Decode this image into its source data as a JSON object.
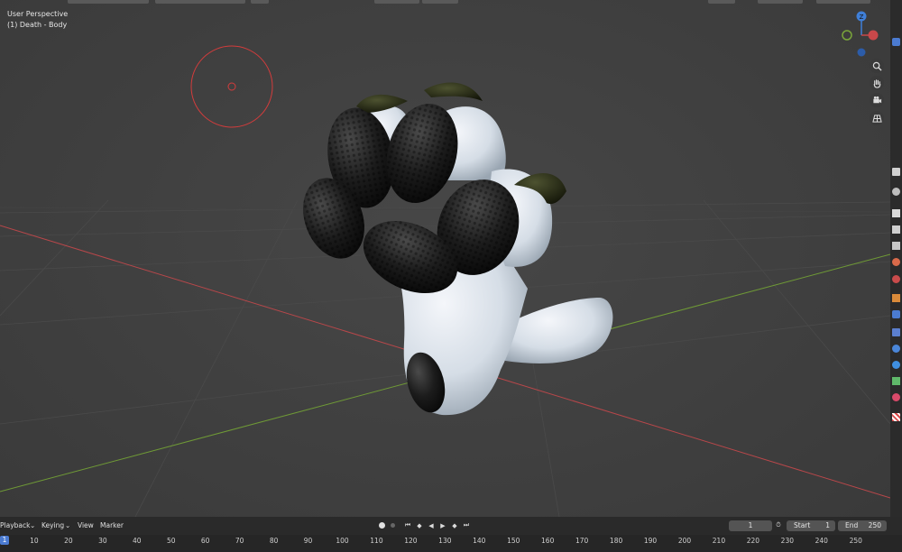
{
  "viewport": {
    "perspective_label": "User Perspective",
    "object_label": "(1) Death - Body",
    "gizmo_axis_label": "Z"
  },
  "nav_icons": [
    "zoom-icon",
    "hand-pan-icon",
    "camera-icon",
    "grid-icon"
  ],
  "timeline": {
    "menus": {
      "playback": "Playback",
      "keying": "Keying",
      "view": "View",
      "marker": "Marker"
    },
    "current_frame": "1",
    "start_label": "Start",
    "start_value": "1",
    "end_label": "End",
    "end_value": "250",
    "ruler_current": "1",
    "ticks": [
      "10",
      "20",
      "30",
      "40",
      "50",
      "60",
      "70",
      "80",
      "90",
      "100",
      "110",
      "120",
      "130",
      "140",
      "150",
      "160",
      "170",
      "180",
      "190",
      "200",
      "210",
      "220",
      "230",
      "240",
      "250"
    ]
  },
  "colors": {
    "axis_x": "#c9484a",
    "axis_y": "#7aa53a",
    "axis_z": "#3f7fd8",
    "accent": "#4b7bd1"
  }
}
